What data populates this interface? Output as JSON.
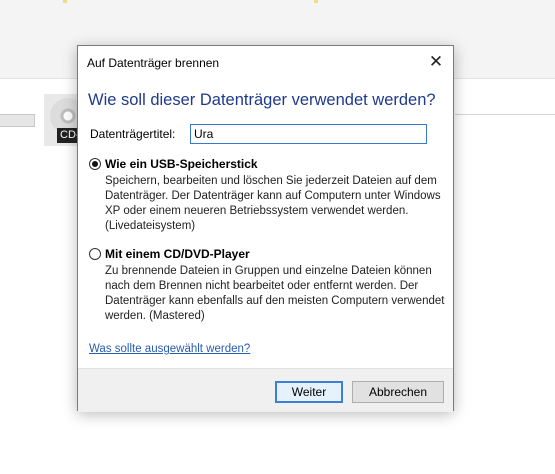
{
  "background": {
    "disc_label": "CD-"
  },
  "dialog": {
    "title": "Auf Datenträger brennen",
    "close_glyph": "✕",
    "heading": "Wie soll dieser Datenträger verwendet werden?",
    "disc_title_label": "Datenträgertitel:",
    "disc_title_value": "Ura",
    "options": [
      {
        "title": "Wie ein USB-Speicherstick",
        "description": "Speichern, bearbeiten und löschen Sie jederzeit Dateien auf dem Datenträger. Der Datenträger kann auf Computern unter Windows XP oder einem neueren Betriebssystem verwendet werden. (Livedateisystem)",
        "selected": true
      },
      {
        "title": "Mit einem CD/DVD-Player",
        "description": "Zu brennende Dateien in Gruppen und einzelne Dateien können nach dem Brennen nicht bearbeitet oder entfernt werden. Der Datenträger kann ebenfalls auf den meisten Computern verwendet werden. (Mastered)",
        "selected": false
      }
    ],
    "help_link": "Was sollte ausgewählt werden?",
    "buttons": {
      "next": "Weiter",
      "cancel": "Abbrechen"
    }
  },
  "colors": {
    "heading": "#1e3a8a",
    "link": "#2a5db0",
    "primary_border": "#3c7fd4"
  }
}
